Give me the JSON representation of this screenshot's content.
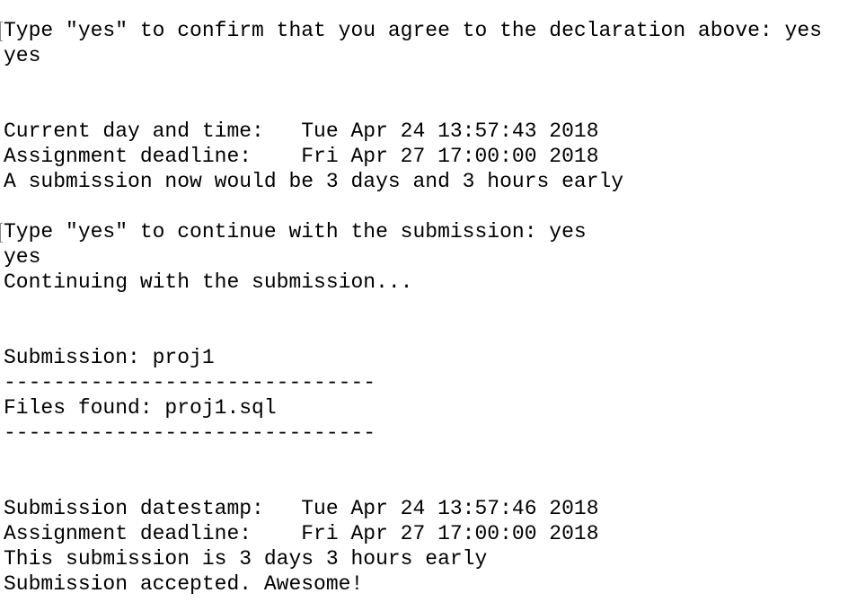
{
  "terminal": {
    "lines": [
      "Type \"yes\" to confirm that you agree to the declaration above: yes",
      "yes",
      "",
      "",
      "Current day and time:   Tue Apr 24 13:57:43 2018",
      "Assignment deadline:    Fri Apr 27 17:00:00 2018",
      "A submission now would be 3 days and 3 hours early",
      "",
      "Type \"yes\" to continue with the submission: yes",
      "yes",
      "Continuing with the submission...",
      "",
      "",
      "Submission: proj1",
      "------------------------------",
      "Files found: proj1.sql",
      "------------------------------",
      "",
      "",
      "Submission datestamp:   Tue Apr 24 13:57:46 2018",
      "Assignment deadline:    Fri Apr 27 17:00:00 2018",
      "This submission is 3 days 3 hours early",
      "Submission accepted. Awesome!"
    ]
  },
  "colors": {
    "background": "#ffffff",
    "text": "#000000",
    "marker": "#8a8a8a"
  }
}
